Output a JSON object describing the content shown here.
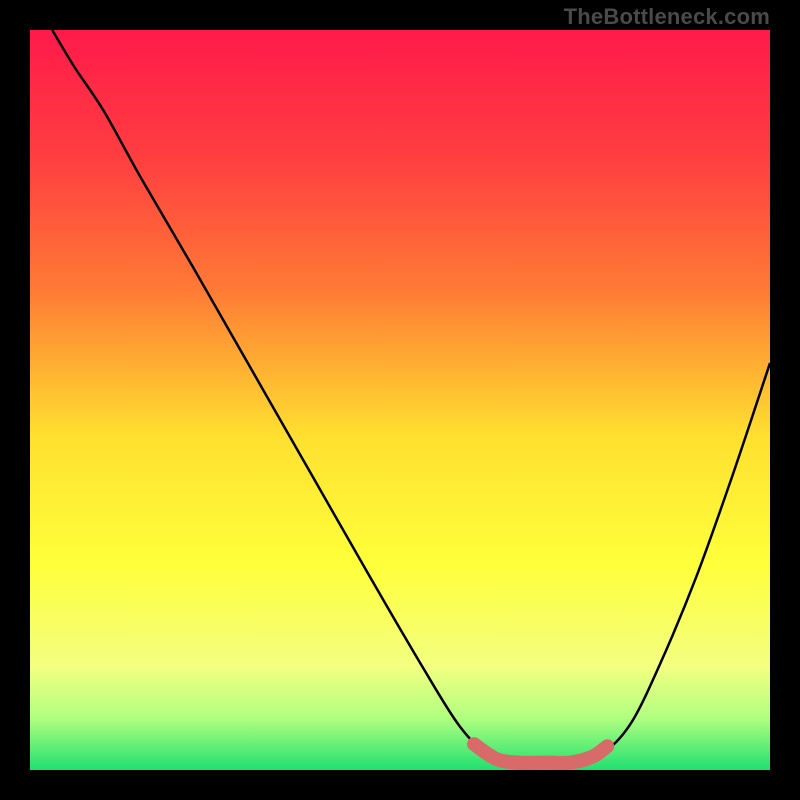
{
  "watermark": "TheBottleneck.com",
  "chart_data": {
    "type": "line",
    "title": "",
    "xlabel": "",
    "ylabel": "",
    "xlim": [
      0,
      100
    ],
    "ylim": [
      0,
      100
    ],
    "gradient_stops": [
      {
        "offset": 0,
        "color": "#ff1a4a"
      },
      {
        "offset": 18,
        "color": "#ff4040"
      },
      {
        "offset": 35,
        "color": "#ff7a35"
      },
      {
        "offset": 55,
        "color": "#ffe030"
      },
      {
        "offset": 72,
        "color": "#ffff3a"
      },
      {
        "offset": 86,
        "color": "#f3ff80"
      },
      {
        "offset": 93,
        "color": "#b0ff80"
      },
      {
        "offset": 100,
        "color": "#20e070"
      }
    ],
    "series": [
      {
        "name": "curve",
        "color": "#000000",
        "points": [
          {
            "x": 3,
            "y": 100
          },
          {
            "x": 6,
            "y": 95
          },
          {
            "x": 10,
            "y": 89
          },
          {
            "x": 15,
            "y": 80
          },
          {
            "x": 22,
            "y": 68
          },
          {
            "x": 30,
            "y": 54
          },
          {
            "x": 38,
            "y": 40
          },
          {
            "x": 46,
            "y": 26
          },
          {
            "x": 53,
            "y": 14
          },
          {
            "x": 58,
            "y": 6
          },
          {
            "x": 62,
            "y": 2
          },
          {
            "x": 66,
            "y": 1
          },
          {
            "x": 73,
            "y": 1
          },
          {
            "x": 77,
            "y": 2
          },
          {
            "x": 81,
            "y": 6
          },
          {
            "x": 85,
            "y": 14
          },
          {
            "x": 90,
            "y": 26
          },
          {
            "x": 95,
            "y": 40
          },
          {
            "x": 100,
            "y": 55
          }
        ]
      },
      {
        "name": "bottleneck-highlight",
        "color": "#d86a6a",
        "points": [
          {
            "x": 60,
            "y": 3.5
          },
          {
            "x": 63,
            "y": 1.5
          },
          {
            "x": 66,
            "y": 1
          },
          {
            "x": 70,
            "y": 1
          },
          {
            "x": 73,
            "y": 1
          },
          {
            "x": 76,
            "y": 1.8
          },
          {
            "x": 78,
            "y": 3.2
          }
        ]
      }
    ]
  }
}
